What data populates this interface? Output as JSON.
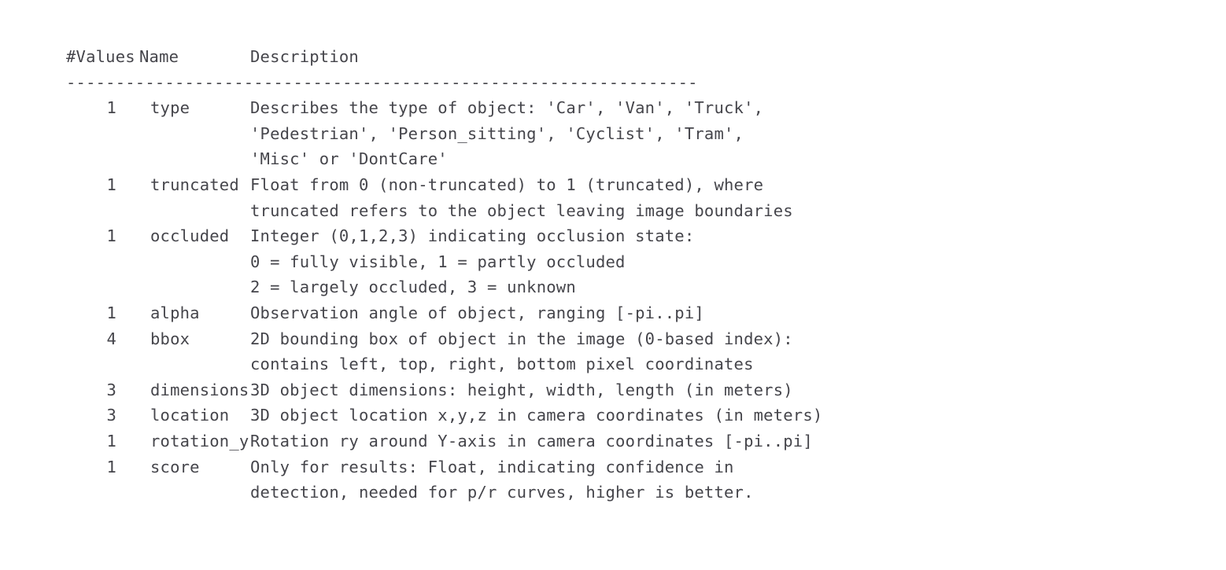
{
  "document": {
    "title": "KITTI object label format description",
    "text_color": "#45454b",
    "background_color": "#ffffff"
  },
  "header": {
    "values": "#Values",
    "name": "Name",
    "description": "Description"
  },
  "divider": "----------------------------------------------------------------",
  "rows": [
    {
      "values": "1",
      "name": "type",
      "description_lines": [
        "Describes the type of object: 'Car', 'Van', 'Truck',",
        "'Pedestrian', 'Person_sitting', 'Cyclist', 'Tram',",
        "'Misc' or 'DontCare'"
      ]
    },
    {
      "values": "1",
      "name": "truncated",
      "description_lines": [
        "Float from 0 (non-truncated) to 1 (truncated), where",
        "truncated refers to the object leaving image boundaries"
      ]
    },
    {
      "values": "1",
      "name": "occluded",
      "description_lines": [
        "Integer (0,1,2,3) indicating occlusion state:",
        "0 = fully visible, 1 = partly occluded",
        "2 = largely occluded, 3 = unknown"
      ]
    },
    {
      "values": "1",
      "name": "alpha",
      "description_lines": [
        "Observation angle of object, ranging [-pi..pi]"
      ]
    },
    {
      "values": "4",
      "name": "bbox",
      "description_lines": [
        "2D bounding box of object in the image (0-based index):",
        "contains left, top, right, bottom pixel coordinates"
      ]
    },
    {
      "values": "3",
      "name": "dimensions",
      "description_lines": [
        "3D object dimensions: height, width, length (in meters)"
      ]
    },
    {
      "values": "3",
      "name": "location",
      "description_lines": [
        "3D object location x,y,z in camera coordinates (in meters)"
      ]
    },
    {
      "values": "1",
      "name": "rotation_y",
      "description_lines": [
        "Rotation ry around Y-axis in camera coordinates [-pi..pi]"
      ]
    },
    {
      "values": "1",
      "name": "score",
      "description_lines": [
        "Only for results: Float, indicating confidence in",
        "detection, needed for p/r curves, higher is better."
      ]
    }
  ]
}
